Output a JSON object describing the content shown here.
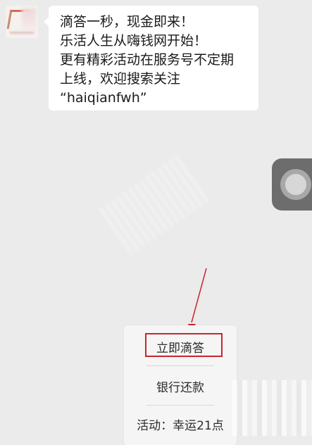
{
  "chat": {
    "message_lines": [
      "滴答一秒，现金即来！",
      "乐活人生从嗨钱网开始！",
      "更有精彩活动在服务号不定期",
      "上线，欢迎搜索关注",
      "“haiqianfwh”"
    ]
  },
  "menu": {
    "items": [
      {
        "label": "立即滴答"
      },
      {
        "label": "银行还款"
      },
      {
        "label": "活动：幸运21点"
      }
    ],
    "highlight_color": "#c8262c"
  },
  "colors": {
    "background": "#ebebeb",
    "bubble": "#ffffff",
    "annotation": "#c8262c"
  },
  "icons": {
    "avatar": "brand-avatar",
    "floating_control": "assistive-touch-icon",
    "annotation_arrow": "red-arrow-icon"
  }
}
